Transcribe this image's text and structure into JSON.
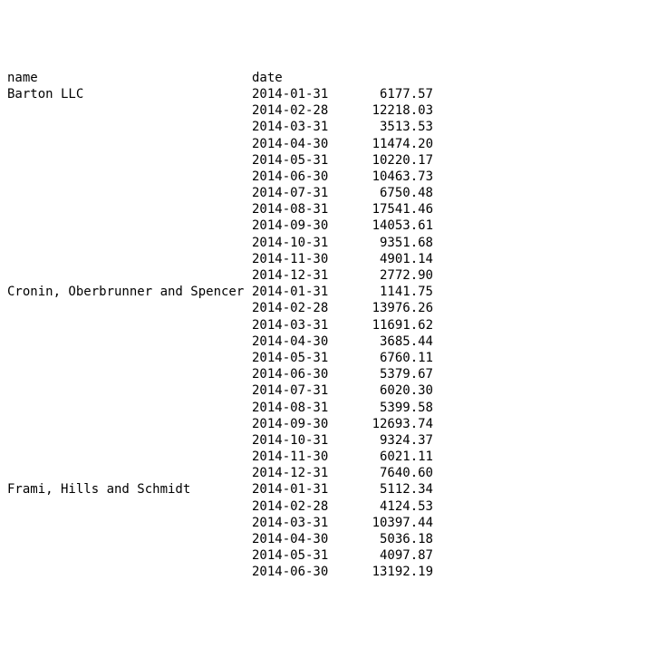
{
  "headers": {
    "name": "name",
    "date": "date"
  },
  "groups": [
    {
      "name": "Barton LLC",
      "rows": [
        {
          "date": "2014-01-31",
          "value": "6177.57"
        },
        {
          "date": "2014-02-28",
          "value": "12218.03"
        },
        {
          "date": "2014-03-31",
          "value": "3513.53"
        },
        {
          "date": "2014-04-30",
          "value": "11474.20"
        },
        {
          "date": "2014-05-31",
          "value": "10220.17"
        },
        {
          "date": "2014-06-30",
          "value": "10463.73"
        },
        {
          "date": "2014-07-31",
          "value": "6750.48"
        },
        {
          "date": "2014-08-31",
          "value": "17541.46"
        },
        {
          "date": "2014-09-30",
          "value": "14053.61"
        },
        {
          "date": "2014-10-31",
          "value": "9351.68"
        },
        {
          "date": "2014-11-30",
          "value": "4901.14"
        },
        {
          "date": "2014-12-31",
          "value": "2772.90"
        }
      ]
    },
    {
      "name": "Cronin, Oberbrunner and Spencer",
      "rows": [
        {
          "date": "2014-01-31",
          "value": "1141.75"
        },
        {
          "date": "2014-02-28",
          "value": "13976.26"
        },
        {
          "date": "2014-03-31",
          "value": "11691.62"
        },
        {
          "date": "2014-04-30",
          "value": "3685.44"
        },
        {
          "date": "2014-05-31",
          "value": "6760.11"
        },
        {
          "date": "2014-06-30",
          "value": "5379.67"
        },
        {
          "date": "2014-07-31",
          "value": "6020.30"
        },
        {
          "date": "2014-08-31",
          "value": "5399.58"
        },
        {
          "date": "2014-09-30",
          "value": "12693.74"
        },
        {
          "date": "2014-10-31",
          "value": "9324.37"
        },
        {
          "date": "2014-11-30",
          "value": "6021.11"
        },
        {
          "date": "2014-12-31",
          "value": "7640.60"
        }
      ]
    },
    {
      "name": "Frami, Hills and Schmidt",
      "rows": [
        {
          "date": "2014-01-31",
          "value": "5112.34"
        },
        {
          "date": "2014-02-28",
          "value": "4124.53"
        },
        {
          "date": "2014-03-31",
          "value": "10397.44"
        },
        {
          "date": "2014-04-30",
          "value": "5036.18"
        },
        {
          "date": "2014-05-31",
          "value": "4097.87"
        },
        {
          "date": "2014-06-30",
          "value": "13192.19"
        }
      ]
    }
  ]
}
